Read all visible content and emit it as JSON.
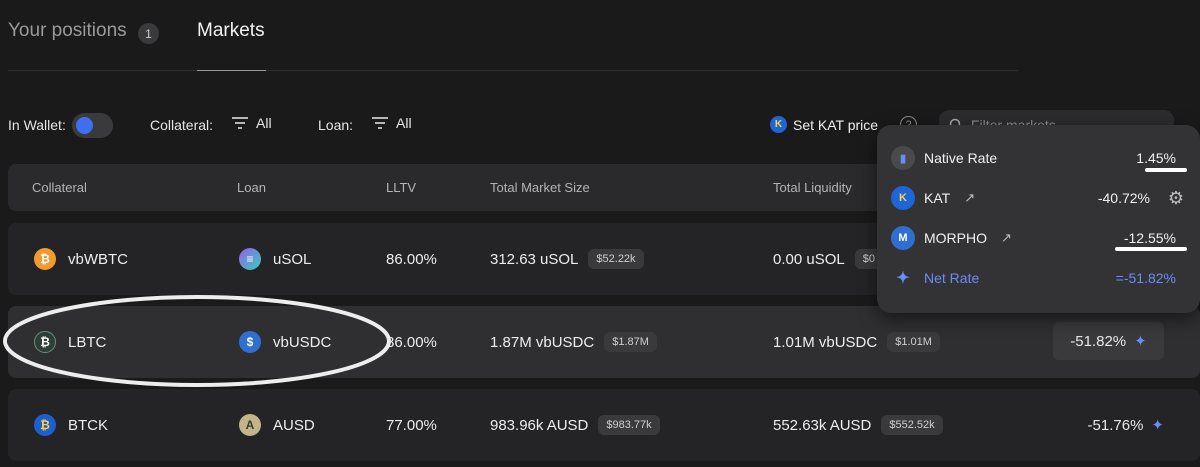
{
  "tabs": {
    "positions_label": "Your positions",
    "positions_count": "1",
    "markets_label": "Markets"
  },
  "filters": {
    "in_wallet_label": "In Wallet:",
    "collateral_label": "Collateral:",
    "collateral_value": "All",
    "loan_label": "Loan:",
    "loan_value": "All",
    "set_kat_price_label": "Set KAT price",
    "search_placeholder": "Filter markets"
  },
  "table": {
    "headers": [
      "Collateral",
      "Loan",
      "LLTV",
      "Total Market Size",
      "Total Liquidity"
    ],
    "rows": [
      {
        "collateral": "vbWBTC",
        "loan": "uSOL",
        "lltv": "86.00%",
        "market_size": "312.63 uSOL",
        "market_size_usd": "$52.22k",
        "liquidity": "0.00 uSOL",
        "liquidity_usd": "$0",
        "rate": ""
      },
      {
        "collateral": "LBTC",
        "loan": "vbUSDC",
        "lltv": "86.00%",
        "market_size": "1.87M vbUSDC",
        "market_size_usd": "$1.87M",
        "liquidity": "1.01M vbUSDC",
        "liquidity_usd": "$1.01M",
        "rate": "-51.82%"
      },
      {
        "collateral": "BTCK",
        "loan": "AUSD",
        "lltv": "77.00%",
        "market_size": "983.96k AUSD",
        "market_size_usd": "$983.77k",
        "liquidity": "552.63k AUSD",
        "liquidity_usd": "$552.52k",
        "rate": "-51.76%"
      }
    ]
  },
  "popover": {
    "native_rate_label": "Native Rate",
    "native_rate_value": "1.45%",
    "kat_label": "KAT",
    "kat_value": "-40.72%",
    "morpho_label": "MORPHO",
    "morpho_value": "-12.55%",
    "net_rate_label": "Net Rate",
    "net_rate_value": "=-51.82%"
  },
  "colors": {
    "accent_blue": "#3f6ff0",
    "net_rate_blue": "#6a8cf5",
    "background": "#1a1a1b"
  },
  "icons": {
    "vbWBTC": "bitcoin-orange-icon",
    "uSOL": "usol-icon",
    "LBTC": "lbtc-icon",
    "vbUSDC": "usdc-icon",
    "BTCK": "btck-icon",
    "AUSD": "ausd-icon"
  }
}
